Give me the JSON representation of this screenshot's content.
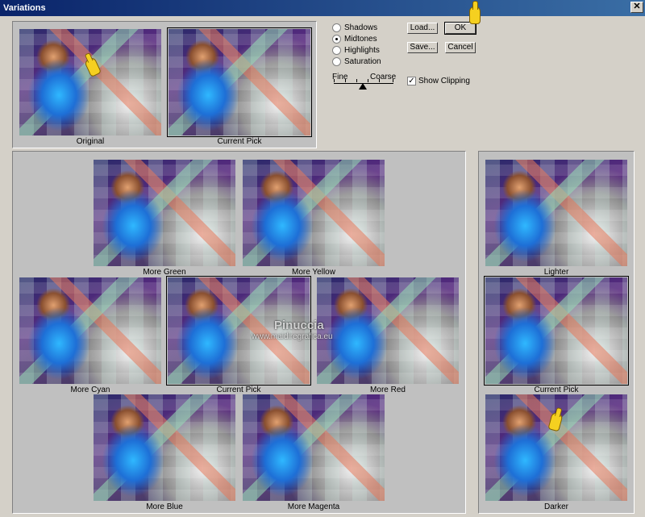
{
  "window": {
    "title": "Variations",
    "close_label": "✕"
  },
  "options": {
    "radios": [
      {
        "label": "Shadows",
        "selected": false
      },
      {
        "label": "Midtones",
        "selected": true
      },
      {
        "label": "Highlights",
        "selected": false
      },
      {
        "label": "Saturation",
        "selected": false
      }
    ],
    "slider": {
      "fine_label": "Fine",
      "coarse_label": "Coarse"
    },
    "show_clipping": {
      "label": "Show Clipping",
      "checked": true
    }
  },
  "buttons": {
    "load": "Load...",
    "ok": "OK",
    "save": "Save...",
    "cancel": "Cancel"
  },
  "top": {
    "original": "Original",
    "current": "Current Pick"
  },
  "color": {
    "more_green": "More Green",
    "more_yellow": "More Yellow",
    "more_cyan": "More Cyan",
    "current": "Current Pick",
    "more_red": "More Red",
    "more_blue": "More Blue",
    "more_magenta": "More Magenta"
  },
  "brightness": {
    "lighter": "Lighter",
    "current": "Current Pick",
    "darker": "Darker"
  },
  "watermark": {
    "line1": "Pinuccia",
    "line2": "www.maidiregrafica.eu"
  }
}
